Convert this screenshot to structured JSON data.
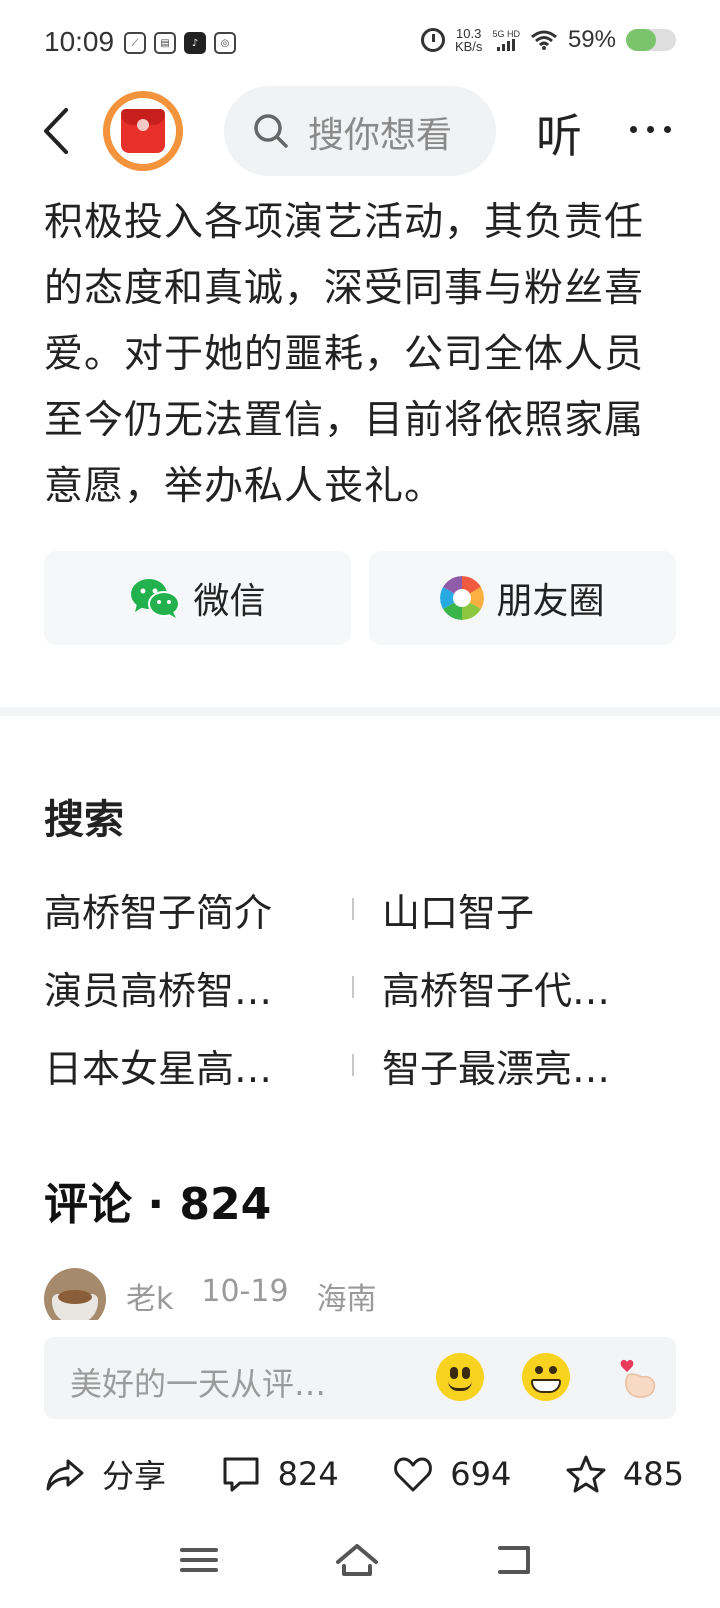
{
  "status_bar": {
    "time": "10:09",
    "speed_value": "10.3",
    "speed_unit": "KB/s",
    "network": "5G HD",
    "battery_percent": "59%",
    "battery_level": 0.59,
    "battery_color": "#7cc46c"
  },
  "header": {
    "search_placeholder": "搜你想看",
    "listen_label": "听"
  },
  "article": {
    "text": "积极投入各项演艺活动，其负责任的态度和真诚，深受同事与粉丝喜爱。对于她的噩耗，公司全体人员至今仍无法置信，目前将依照家属意愿，举办私人丧礼。"
  },
  "share": {
    "wechat_label": "微信",
    "moments_label": "朋友圈"
  },
  "related_search": {
    "title": "搜索",
    "items": [
      "高桥智子简介",
      "山口智子",
      "演员高桥智…",
      "高桥智子代…",
      "日本女星高…",
      "智子最漂亮…"
    ]
  },
  "comments": {
    "title": "评论",
    "count": "824",
    "first": {
      "user": "老k",
      "date": "10-19",
      "location": "海南"
    },
    "input_placeholder": "美好的一天从评…"
  },
  "actions": {
    "share_label": "分享",
    "comment_count": "824",
    "like_count": "694",
    "favorite_count": "485"
  }
}
